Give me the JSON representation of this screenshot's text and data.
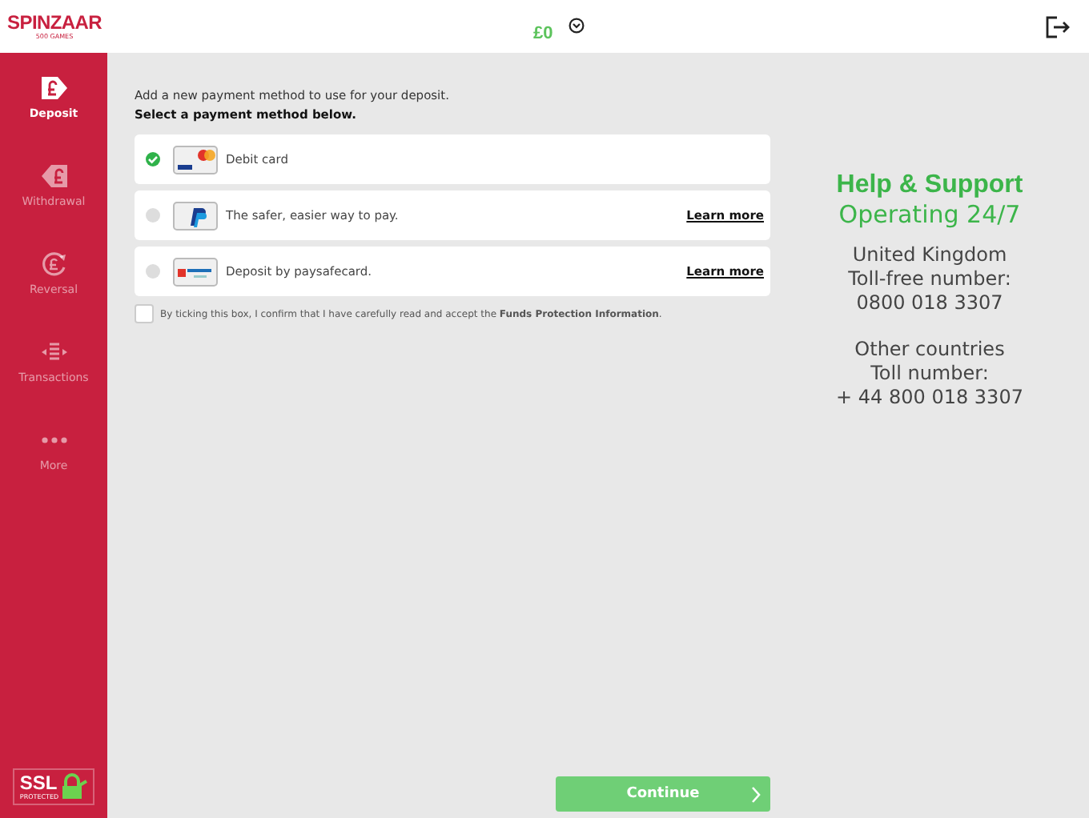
{
  "header": {
    "logo": "SPINZAAR",
    "logo_sub": "500 GAMES",
    "balance": "£0"
  },
  "sidebar": {
    "items": [
      {
        "kind": "deposit",
        "label": "Deposit",
        "selected": true
      },
      {
        "kind": "withdrawal",
        "label": "Withdrawal",
        "selected": false
      },
      {
        "kind": "reversal",
        "label": "Reversal",
        "selected": false
      },
      {
        "kind": "transactions",
        "label": "Transactions",
        "selected": false
      },
      {
        "kind": "more",
        "label": "More",
        "selected": false
      }
    ],
    "ssl": {
      "label": "SSL",
      "sub": "PROTECTED"
    }
  },
  "intro": "Add a new payment method to use for your deposit.",
  "instruction": "Select a payment method below.",
  "methods": [
    {
      "kind": "card",
      "label": "Debit card",
      "selected": true
    },
    {
      "kind": "paypal",
      "label": "The safer, easier way to pay.",
      "link": "Learn more",
      "selected": false
    },
    {
      "kind": "paysafe",
      "label": "Deposit by paysafecard.",
      "link": "Learn more",
      "selected": false
    }
  ],
  "consent": {
    "text": "By ticking this box, I confirm that I have carefully read and accept the **Funds Protection Information**.",
    "checked": false
  },
  "support": {
    "title": "Help & Support",
    "subtitle": "Operating 24/7",
    "blocks": [
      {
        "lines": [
          "United Kingdom",
          "Toll-free number:",
          "0800 018 3307"
        ]
      },
      {
        "lines": [
          "Other countries",
          "Toll number:",
          "+ 44 800 018 3307"
        ]
      }
    ]
  },
  "continue": {
    "label": "Continue"
  }
}
